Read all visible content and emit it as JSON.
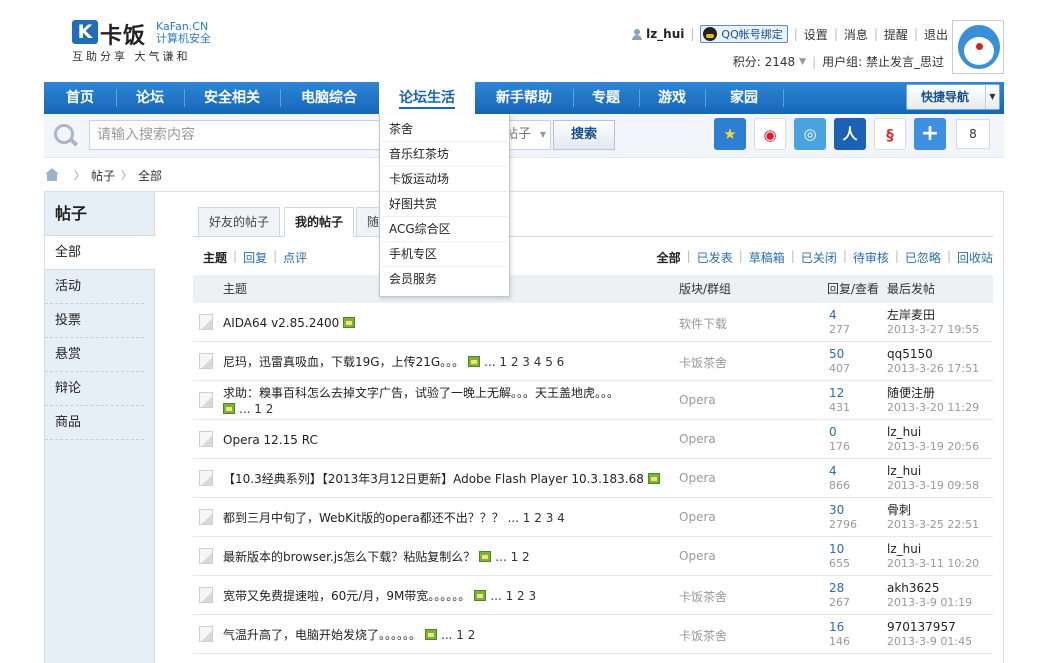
{
  "logo": {
    "mark": "K",
    "name": "卡饭",
    "site_en": "KaFan.CN",
    "site_cn": "计算机安全",
    "tagline": "互助分享  大气谦和"
  },
  "user": {
    "name": "lz_hui",
    "qq_bind": "QQ帐号绑定",
    "links": [
      "设置",
      "消息",
      "提醒",
      "退出"
    ],
    "points": "积分: 2148",
    "group": "用户组: 禁止发言_思过"
  },
  "nav": {
    "items": [
      "首页",
      "论坛",
      "安全相关",
      "电脑综合",
      "论坛生活",
      "新手帮助",
      "专题",
      "游戏",
      "家园"
    ],
    "active": "论坛生活",
    "quick": "快捷导航"
  },
  "dropdown": [
    "茶舍",
    "音乐红茶坊",
    "卡饭运动场",
    "好图共赏",
    "ACG综合区",
    "手机专区",
    "会员服务"
  ],
  "search": {
    "placeholder": "请输入搜索内容",
    "scope": "帖子",
    "button": "搜索"
  },
  "share": {
    "icons": [
      "qzone-icon",
      "weibo-icon",
      "tencent-weibo-icon",
      "renren-icon",
      "netease-icon",
      "plus-icon"
    ],
    "count": "8"
  },
  "breadcrumb": [
    "帖子",
    "全部"
  ],
  "sidebar": {
    "title": "帖子",
    "items": [
      "全部",
      "活动",
      "投票",
      "悬赏",
      "辩论",
      "商品"
    ]
  },
  "tabs": [
    "好友的帖子",
    "我的帖子",
    "随"
  ],
  "filters_left": [
    "主题",
    "回复",
    "点评"
  ],
  "filters_right": [
    "全部",
    "已发表",
    "草稿箱",
    "已关闭",
    "待审核",
    "已忽略",
    "回收站"
  ],
  "columns": {
    "subject": "主题",
    "board": "版块/群组",
    "reply": "回复/查看",
    "last": "最后发帖"
  },
  "rows": [
    {
      "subject": "AIDA64 v2.85.2400",
      "img": true,
      "pages": "",
      "board": "软件下载",
      "replies": "4",
      "views": "277",
      "user": "左岸麦田",
      "time": "2013-3-27 19:55"
    },
    {
      "subject": "尼玛，迅雷真吸血，下载19G，上传21G。。。",
      "img": true,
      "pages": "... 1 2 3 4 5 6",
      "board": "卡饭茶舍",
      "replies": "50",
      "views": "407",
      "user": "qq5150",
      "time": "2013-3-26 17:51"
    },
    {
      "subject": "求助：糗事百科怎么去掉文字广告，试验了一晚上无解。。。天王盖地虎。。。",
      "img": true,
      "pages": "... 1 2",
      "board": "Opera",
      "replies": "12",
      "views": "431",
      "user": "随便注册",
      "time": "2013-3-20 11:29"
    },
    {
      "subject": "Opera 12.15 RC",
      "img": false,
      "pages": "",
      "board": "Opera",
      "replies": "0",
      "views": "176",
      "user": "lz_hui",
      "time": "2013-3-19 20:56"
    },
    {
      "subject": "【10.3经典系列】【2013年3月12日更新】Adobe Flash Player 10.3.183.68",
      "img": true,
      "pages": "",
      "board": "Opera",
      "replies": "4",
      "views": "866",
      "user": "lz_hui",
      "time": "2013-3-19 09:58"
    },
    {
      "subject": "都到三月中旬了，WebKit版的opera都还不出？？？",
      "img": false,
      "pages": "... 1 2 3 4",
      "board": "Opera",
      "replies": "30",
      "views": "2796",
      "user": "骨刺",
      "time": "2013-3-25 22:51"
    },
    {
      "subject": "最新版本的browser.js怎么下载？粘贴复制么？",
      "img": true,
      "pages": "... 1 2",
      "board": "Opera",
      "replies": "10",
      "views": "655",
      "user": "lz_hui",
      "time": "2013-3-11 10:20"
    },
    {
      "subject": "宽带又免费提速啦，60元/月，9M带宽。。。。。。",
      "img": true,
      "pages": "... 1 2 3",
      "board": "卡饭茶舍",
      "replies": "28",
      "views": "267",
      "user": "akh3625",
      "time": "2013-3-9 01:19"
    },
    {
      "subject": "气温升高了，电脑开始发烧了。。。。。。",
      "img": true,
      "pages": "... 1 2",
      "board": "卡饭茶舍",
      "replies": "16",
      "views": "146",
      "user": "970137957",
      "time": "2013-3-9 01:45"
    }
  ]
}
